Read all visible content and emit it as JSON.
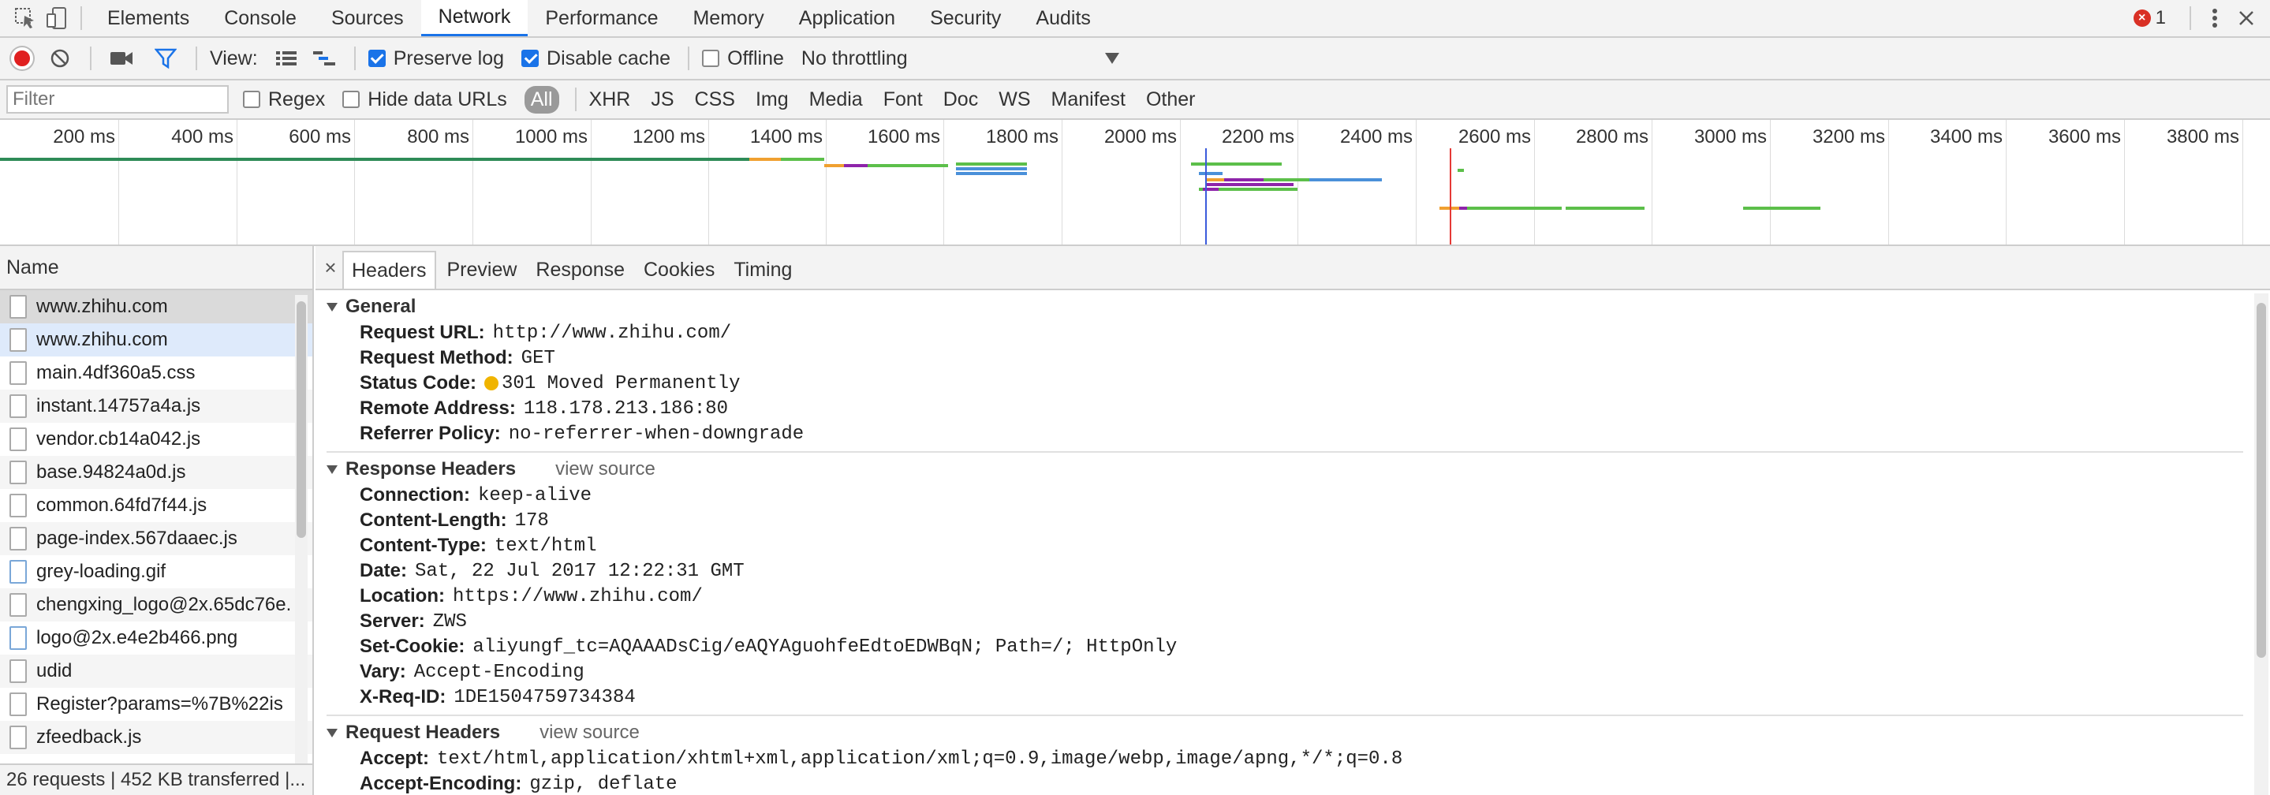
{
  "tabs": {
    "items": [
      "Elements",
      "Console",
      "Sources",
      "Network",
      "Performance",
      "Memory",
      "Application",
      "Security",
      "Audits"
    ],
    "active": "Network",
    "error_count": "1"
  },
  "toolbar": {
    "view_label": "View:",
    "preserve_log": {
      "label": "Preserve log",
      "checked": true
    },
    "disable_cache": {
      "label": "Disable cache",
      "checked": true
    },
    "offline": {
      "label": "Offline",
      "checked": false
    },
    "throttling": "No throttling"
  },
  "filter": {
    "placeholder": "Filter",
    "regex": "Regex",
    "hide_data_urls": "Hide data URLs",
    "types": [
      "All",
      "XHR",
      "JS",
      "CSS",
      "Img",
      "Media",
      "Font",
      "Doc",
      "WS",
      "Manifest",
      "Other"
    ],
    "active_type": "All"
  },
  "overview": {
    "ticks": [
      "200 ms",
      "400 ms",
      "600 ms",
      "800 ms",
      "1000 ms",
      "1200 ms",
      "1400 ms",
      "1600 ms",
      "1800 ms",
      "2000 ms",
      "2200 ms",
      "2400 ms",
      "2600 ms",
      "2800 ms",
      "3000 ms",
      "3200 ms",
      "3400 ms",
      "3600 ms",
      "3800 ms"
    ]
  },
  "requests": {
    "header": "Name",
    "items": [
      {
        "name": "www.zhihu.com",
        "icon": "document-icon"
      },
      {
        "name": "www.zhihu.com",
        "icon": "document-icon"
      },
      {
        "name": "main.4df360a5.css",
        "icon": "document-icon"
      },
      {
        "name": "instant.14757a4a.js",
        "icon": "document-icon"
      },
      {
        "name": "vendor.cb14a042.js",
        "icon": "document-icon"
      },
      {
        "name": "base.94824a0d.js",
        "icon": "document-icon"
      },
      {
        "name": "common.64fd7f44.js",
        "icon": "document-icon"
      },
      {
        "name": "page-index.567daaec.js",
        "icon": "document-icon"
      },
      {
        "name": "grey-loading.gif",
        "icon": "image-icon"
      },
      {
        "name": "chengxing_logo@2x.65dc76e.",
        "icon": "document-icon"
      },
      {
        "name": "logo@2x.e4e2b466.png",
        "icon": "image-icon"
      },
      {
        "name": "udid",
        "icon": "document-icon"
      },
      {
        "name": "Register?params=%7B%22is",
        "icon": "document-icon"
      },
      {
        "name": "zfeedback.js",
        "icon": "document-icon"
      }
    ],
    "status": "26 requests | 452 KB transferred |..."
  },
  "details": {
    "tabs": [
      "Headers",
      "Preview",
      "Response",
      "Cookies",
      "Timing"
    ],
    "active_tab": "Headers",
    "general": {
      "title": "General",
      "rows": [
        {
          "name": "Request URL:",
          "value": "http://www.zhihu.com/"
        },
        {
          "name": "Request Method:",
          "value": "GET"
        },
        {
          "name": "Status Code:",
          "value": "301 Moved Permanently"
        },
        {
          "name": "Remote Address:",
          "value": "118.178.213.186:80"
        },
        {
          "name": "Referrer Policy:",
          "value": "no-referrer-when-downgrade"
        }
      ]
    },
    "response_headers": {
      "title": "Response Headers",
      "view_source": "view source",
      "rows": [
        {
          "name": "Connection:",
          "value": "keep-alive"
        },
        {
          "name": "Content-Length:",
          "value": "178"
        },
        {
          "name": "Content-Type:",
          "value": "text/html"
        },
        {
          "name": "Date:",
          "value": "Sat, 22 Jul 2017 12:22:31 GMT"
        },
        {
          "name": "Location:",
          "value": "https://www.zhihu.com/"
        },
        {
          "name": "Server:",
          "value": "ZWS"
        },
        {
          "name": "Set-Cookie:",
          "value": "aliyungf_tc=AQAAADsCig/eAQYAguohfeEdtoEDWBqN; Path=/; HttpOnly"
        },
        {
          "name": "Vary:",
          "value": "Accept-Encoding"
        },
        {
          "name": "X-Req-ID:",
          "value": "1DE1504759734384"
        }
      ]
    },
    "request_headers": {
      "title": "Request Headers",
      "view_source": "view source",
      "rows": [
        {
          "name": "Accept:",
          "value": "text/html,application/xhtml+xml,application/xml;q=0.9,image/webp,image/apng,*/*;q=0.8"
        },
        {
          "name": "Accept-Encoding:",
          "value": "gzip, deflate"
        }
      ]
    }
  }
}
